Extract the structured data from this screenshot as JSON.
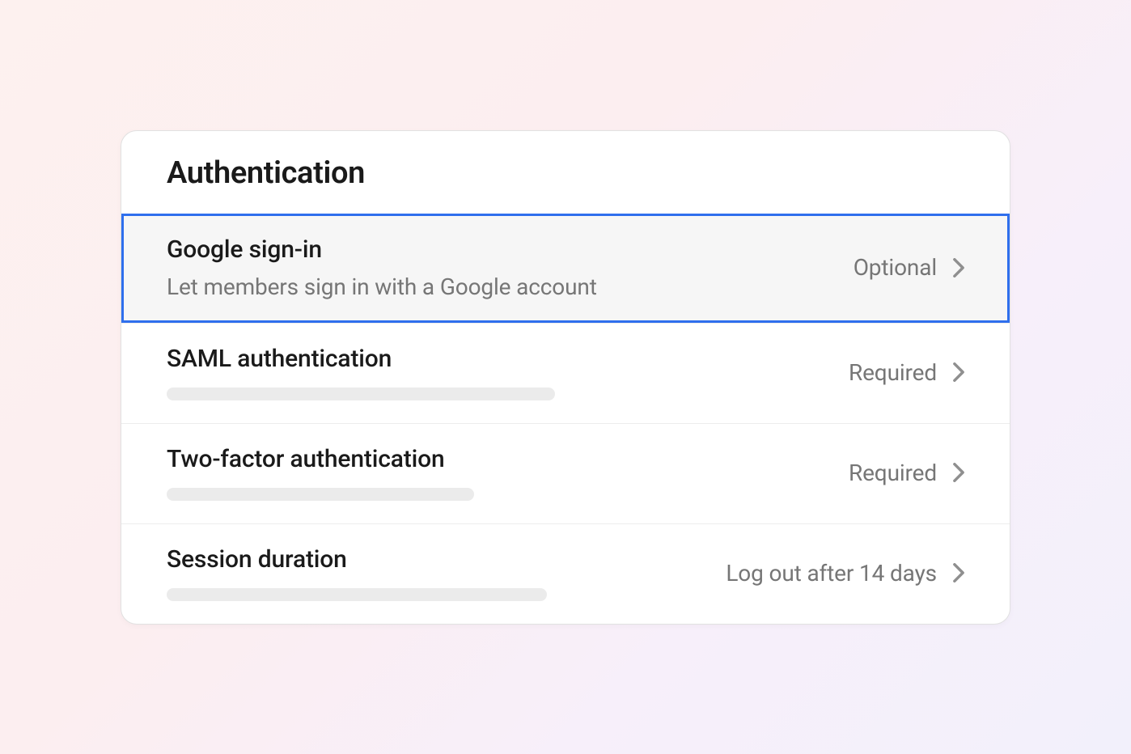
{
  "header": {
    "title": "Authentication"
  },
  "rows": [
    {
      "title": "Google sign-in",
      "description": "Let members sign in with a Google account",
      "status": "Optional",
      "selected": true,
      "hasDescription": true
    },
    {
      "title": "SAML authentication",
      "status": "Required",
      "selected": false,
      "placeholderWidth": 480
    },
    {
      "title": "Two-factor authentication",
      "status": "Required",
      "selected": false,
      "placeholderWidth": 380
    },
    {
      "title": "Session duration",
      "status": "Log out after 14 days",
      "selected": false,
      "placeholderWidth": 470
    }
  ]
}
